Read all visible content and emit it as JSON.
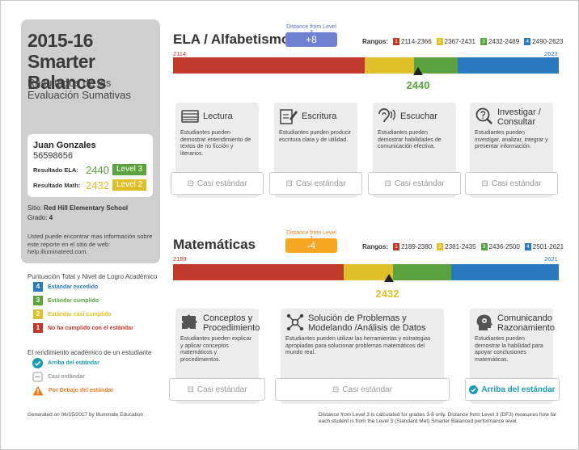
{
  "title": "2015-16 Smarter Balances",
  "subtitle": "Resultados de las Evaluación Sumativas",
  "student": {
    "name": "Juan Gonzales",
    "id": "56598656",
    "ela_label": "Resultado ELA:",
    "ela_score": "2440",
    "ela_level": "Level 3",
    "math_label": "Resultado Math:",
    "math_score": "2432",
    "math_level": "Level 2"
  },
  "site_label": "Sitio:",
  "site_value": "Red Hill Elementary School",
  "grade_label": "Grado:",
  "grade_value": "4",
  "info_text": "Usted puede encontrar mas información sobre este reporte en el sitio de web: help.illuminateed.com.",
  "legend": {
    "title": "Puntuación Total y Nivel de Logro Académico",
    "items": [
      {
        "num": "4",
        "text": "Estándar excedido",
        "color": "#2a7ac0"
      },
      {
        "num": "3",
        "text": "Estándar cumplido",
        "color": "#5aa33e"
      },
      {
        "num": "2",
        "text": "Estándar casi cumplido",
        "color": "#e0c02a"
      },
      {
        "num": "1",
        "text": "No ha cumplido con el estándar",
        "color": "#c0392b"
      }
    ]
  },
  "legend2": {
    "title": "El rendimiento académico de un estudiante",
    "items": [
      {
        "icon": "check-circle-icon",
        "text": "Arriba del estándar",
        "color": "#1a9bb5"
      },
      {
        "icon": "minus-box-icon",
        "text": "Casi estándar",
        "color": "#999999"
      },
      {
        "icon": "warning-icon",
        "text": "Por Debajo del estándar",
        "color": "#e67e22"
      }
    ]
  },
  "footer_left": "Generated on 06/15/2017 by Illuminate Education",
  "footer_right": "Distance from Level 3 is calculated for grades 3-8 only. Distance from Level 3 (DF3) measures how far each student is from the Level 3 (Standard Met) Smarter Balanced performance level.",
  "ela": {
    "title": "ELA / Alfabetismo",
    "distance_label": "Distance from Level 3",
    "distance_value": "+8",
    "rangos_label": "Rangos:",
    "ranges": [
      {
        "num": "1",
        "text": "2114-2366",
        "color": "#c0392b"
      },
      {
        "num": "2",
        "text": "2367-2431",
        "color": "#e0c02a"
      },
      {
        "num": "3",
        "text": "2432-2489",
        "color": "#5aa33e"
      },
      {
        "num": "4",
        "text": "2490-2623",
        "color": "#2a7ac0"
      }
    ],
    "min": "2114",
    "max": "2623",
    "score": "2440",
    "cards": [
      {
        "icon": "book-icon",
        "title": "Lectura",
        "desc": "Estudiantes pueden demostrar entendimiento de textos de no ficción y literarios.",
        "status": "Casi estándar"
      },
      {
        "icon": "pencil-icon",
        "title": "Escritura",
        "desc": "Estudiantes pueden producir escritura clara y de utilidad.",
        "status": "Casi estándar"
      },
      {
        "icon": "ear-icon",
        "title": "Escuchar",
        "desc": "Estudiantes pueden demostrar habilidades de comunicación efectiva.",
        "status": "Casi estándar"
      },
      {
        "icon": "question-search-icon",
        "title": "Investigar / Consultar",
        "desc": "Estudiantes pueden investigar, analizar, integrar y presentar información.",
        "status": "Casi estándar"
      }
    ]
  },
  "math": {
    "title": "Matemáticas",
    "distance_label": "Distance from Level 3",
    "distance_value": "-4",
    "rangos_label": "Rangos:",
    "ranges": [
      {
        "num": "1",
        "text": "2189-2380",
        "color": "#c0392b"
      },
      {
        "num": "2",
        "text": "2381-2435",
        "color": "#e0c02a"
      },
      {
        "num": "3",
        "text": "2436-2500",
        "color": "#5aa33e"
      },
      {
        "num": "4",
        "text": "2501-2621",
        "color": "#2a7ac0"
      }
    ],
    "min": "2189",
    "max": "2621",
    "score": "2432",
    "cards": [
      {
        "icon": "puzzle-icon",
        "title": "Conceptos y Procedimiento",
        "desc": "Estudiantes pueden explicar y aplicar conceptos matemáticos y procedimientos.",
        "status": "Casi estándar"
      },
      {
        "icon": "network-icon",
        "title": "Solución de Problemas y Modelando /Análisis de Datos",
        "desc": "Estudiantes pueden utilizar las herramientas y estrategias apropiadas para solucionar problemas matemáticos del mundo real.",
        "status": "Casi estándar"
      },
      {
        "icon": "head-gears-icon",
        "title": "Comunicando Razonamiento",
        "desc": "Estudiantes pueden demostrar la habilidad para apoyar conclusiones matemáticas.",
        "status": "Arriba del estándar"
      }
    ]
  }
}
